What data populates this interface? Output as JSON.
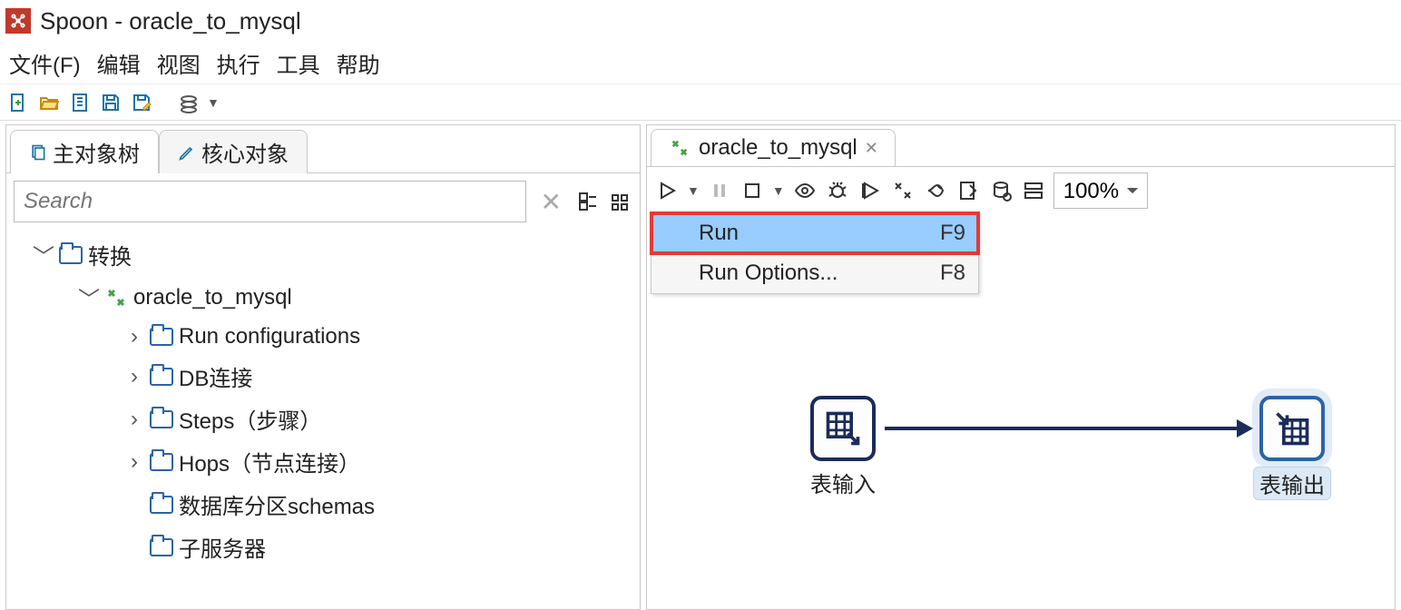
{
  "window": {
    "title": "Spoon - oracle_to_mysql"
  },
  "menubar": {
    "file": "文件(F)",
    "edit": "编辑",
    "view": "视图",
    "run": "执行",
    "tools": "工具",
    "help": "帮助"
  },
  "left": {
    "tab_main_tree": "主对象树",
    "tab_core_objects": "核心对象",
    "search_placeholder": "Search",
    "tree": {
      "root": "转换",
      "transformation": "oracle_to_mysql",
      "children": [
        "Run configurations",
        "DB连接",
        "Steps（步骤）",
        "Hops（节点连接）",
        "数据库分区schemas",
        "子服务器"
      ]
    }
  },
  "right": {
    "tab_label": "oracle_to_mysql",
    "zoom": "100%",
    "popup": {
      "run_label": "Run",
      "run_shortcut": "F9",
      "runopts_label": "Run Options...",
      "runopts_shortcut": "F8"
    },
    "node_input_label": "表输入",
    "node_output_label": "表输出"
  }
}
